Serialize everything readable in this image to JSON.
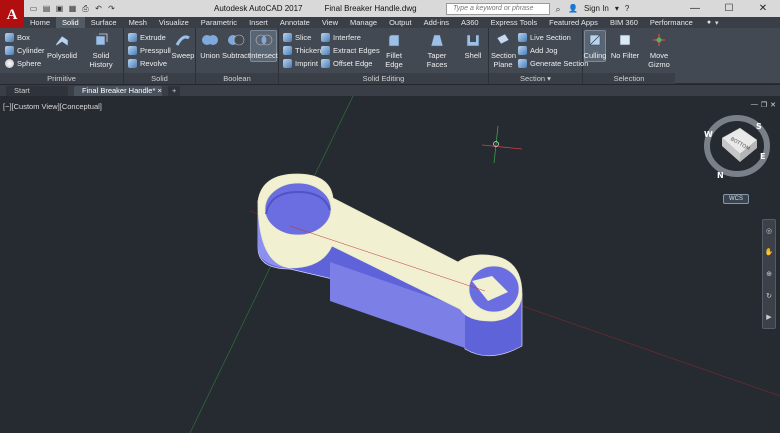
{
  "app": {
    "logo": "A",
    "title": "Autodesk AutoCAD 2017",
    "filename": "Final Breaker Handle.dwg",
    "search_placeholder": "Type a keyword or phrase",
    "signin": "Sign In"
  },
  "ribbon_tabs": [
    "Home",
    "Solid",
    "Surface",
    "Mesh",
    "Visualize",
    "Parametric",
    "Insert",
    "Annotate",
    "View",
    "Manage",
    "Output",
    "Add-ins",
    "A360",
    "Express Tools",
    "Featured Apps",
    "BIM 360",
    "Performance"
  ],
  "active_tab": "Solid",
  "panels": {
    "primitive": {
      "title": "Primitive",
      "box": "Box",
      "cylinder": "Cylinder",
      "sphere": "Sphere",
      "polysolid": "Polysolid",
      "solid_history": "Solid History"
    },
    "solid": {
      "title": "Solid",
      "extrude": "Extrude",
      "presspull": "Presspull",
      "revolve": "Revolve",
      "sweep": "Sweep"
    },
    "boolean": {
      "title": "Boolean",
      "union": "Union",
      "subtract": "Subtract",
      "intersect": "Intersect"
    },
    "solid_editing": {
      "title": "Solid Editing",
      "slice": "Slice",
      "thicken": "Thicken",
      "imprint": "Imprint",
      "interfere": "Interfere",
      "extract_edges": "Extract Edges",
      "offset_edge": "Offset Edge",
      "fillet_edge": "Fillet Edge",
      "taper_faces": "Taper Faces",
      "shell": "Shell"
    },
    "section": {
      "title": "Section",
      "section_plane": "Section Plane",
      "live_section": "Live Section",
      "add_jog": "Add Jog",
      "generate_section": "Generate Section"
    },
    "selection": {
      "title": "Selection",
      "culling": "Culling",
      "no_filter": "No Filter",
      "move_gizmo": "Move Gizmo"
    }
  },
  "doc_tabs": {
    "start": "Start",
    "drawing": "Final Breaker Handle*"
  },
  "viewport": {
    "label": "[−][Custom View][Conceptual]",
    "viewcube": {
      "face": "BOTTOM",
      "n": "N",
      "s": "S",
      "e": "E",
      "w": "W"
    },
    "wcs": "WCS"
  },
  "colors": {
    "accent": "#b10f0f",
    "model_side": "#6a6ee0",
    "model_top": "#f2f2d8"
  }
}
